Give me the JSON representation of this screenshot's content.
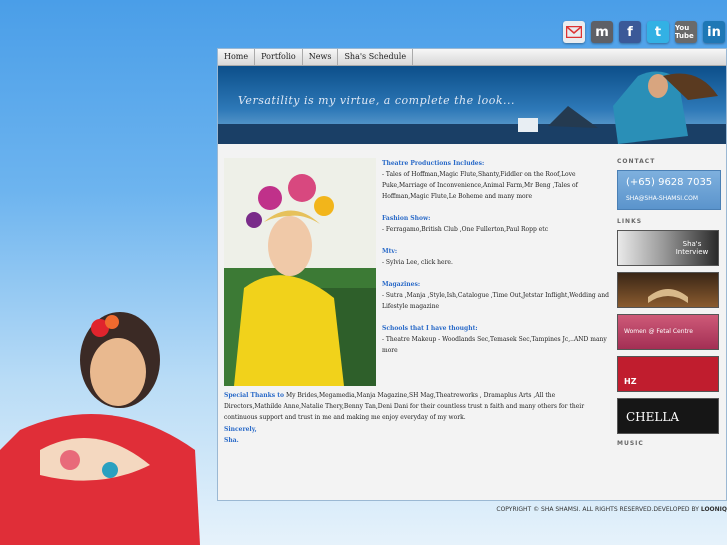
{
  "social": [
    "mail-icon",
    "myspace-icon",
    "facebook-icon",
    "twitter-icon",
    "youtube-icon",
    "linkedin-icon"
  ],
  "social_text": {
    "mspace": "m",
    "fb": "f",
    "tw": "t",
    "yt": "You Tube",
    "li": "in"
  },
  "nav": [
    "Home",
    "Portfolio",
    "News",
    "Sha's Schedule"
  ],
  "banner_tagline": "Versatility is my virtue, a complete the look...",
  "sections": [
    {
      "heading": "Theatre Productions Includes:",
      "body": "- Tales of Hoffman,Magic Flute,Shanty,Fiddler on the Roof,Love Puke,Marriage of Inconvenience,Animal Farm,Mr Beng ,Tales of Hoffman,Magic Flute,Le Boheme and many more"
    },
    {
      "heading": "Fashion Show:",
      "body": "- Ferragamo,British Club ,One Fullerton,Paul Ropp etc"
    },
    {
      "heading": "Mtv:",
      "body": "- Sylvia Lee, click here."
    },
    {
      "heading": "Magazines:",
      "body": "- Sutra ,Manja ,Style,Ish,Catalogue ,Time Out,Jetstar Inflight,Wedding and Lifestyle magazine"
    },
    {
      "heading": "Schools that I have thought:",
      "body": "- Theatre Makeup - Woodlands Sec,Temasek Sec,Tampines Jc,..AND many more"
    }
  ],
  "thanks": {
    "heading": "Special Thanks to",
    "body": "My Brides,Megamedia,Manja Magazine,SH Mag,Theatreworks , Dramaplus Arts ,All the Directors,Mathilde Anne,Natalie Thery,Benny Tan,Deni Dani for their countless trust n faith and many others for their continuous support and trust in me and making me enjoy everyday of my work."
  },
  "sign": {
    "line1": "Sincerely,",
    "line2": "Sha."
  },
  "side": {
    "contact_label": "CONTACT",
    "phone": "(+65) 9628 7035",
    "email": "SHA@SHA-SHAMSI.COM",
    "links_label": "LINKS",
    "music_label": "MUSIC",
    "links": [
      {
        "text": "Sha's Interview"
      },
      {
        "text": ""
      },
      {
        "text": "Women @ Fetal Centre"
      },
      {
        "text": "HZ"
      },
      {
        "text": "CHELLA"
      }
    ]
  },
  "footer": {
    "text": "COPYRIGHT © SHA SHAMSI. ALL RIGHTS RESERVED.DEVELOPED BY ",
    "brand": "LOONIQ"
  }
}
